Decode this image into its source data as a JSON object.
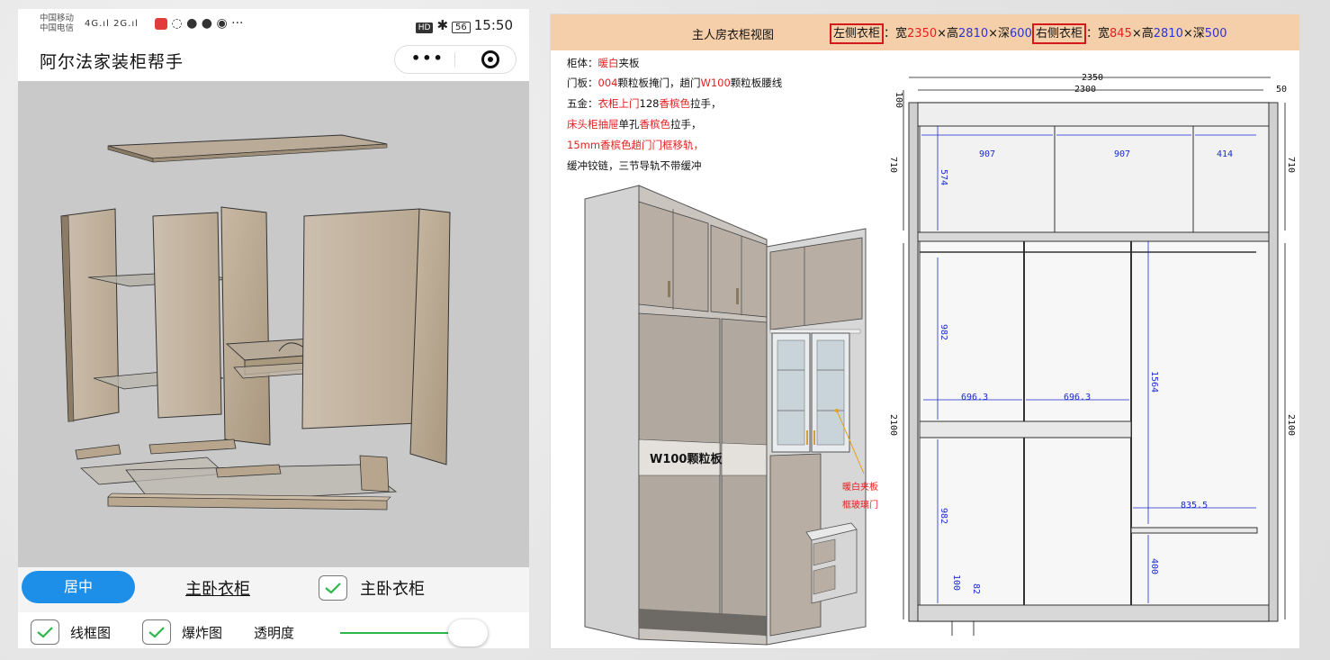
{
  "status": {
    "carrier1": "中国移动",
    "carrier2": "中国电信",
    "net1": "4G",
    "net2": "2G",
    "battery": "56",
    "time": "15:50",
    "hd": "HD"
  },
  "app": {
    "title": "阿尔法家装柜帮手",
    "more_label": "•••"
  },
  "controls": {
    "center_label": "居中",
    "model_link": "主卧衣柜",
    "model_check_label": "主卧衣柜",
    "wireframe_label": "线框图",
    "explode_label": "爆炸图",
    "opacity_label": "透明度",
    "opacity_value": 1.0,
    "accent": "#1e8fe8",
    "check_color": "#2db84c"
  },
  "sheet": {
    "title": "主人房衣柜视图",
    "left_label": "左侧衣柜",
    "left_w": "2350",
    "left_h": "2810",
    "left_d": "600",
    "right_label": "右侧衣柜",
    "right_w": "845",
    "right_h": "2810",
    "right_d": "500",
    "w_prefix": "：宽",
    "h_prefix": "×高",
    "d_prefix": "×深",
    "spec1_a": "柜体：",
    "spec1_b": "暖白",
    "spec1_c": "夹板",
    "spec2_a": "门板：",
    "spec2_b": "004",
    "spec2_c": "颗粒板掩门，趟门",
    "spec2_d": "W100",
    "spec2_e": "颗粒板腰线",
    "spec3_a": "五金：",
    "spec3_b": "衣柜上门",
    "spec3_c": "128",
    "spec3_d": "香槟色",
    "spec3_e": "拉手，",
    "spec4_a": "床头柜抽屉",
    "spec4_b": "单孔",
    "spec4_c": "香槟色",
    "spec4_d": "拉手，",
    "spec5_a": "15mm",
    "spec5_b": "香槟色",
    "spec5_c": "趟门门框移轨，",
    "spec6": "缓冲铰链，三节导轨不带缓冲",
    "panel_label": "W100颗粒板",
    "callout1": "暖白夹板",
    "callout2": "框玻璃门",
    "accent_bg": "#f5cfa9"
  },
  "dims": {
    "overall": "2350",
    "inner": "2300",
    "right_gap": "50",
    "top_gap": "100",
    "top_h_left": "710",
    "top_h_right": "710",
    "top_inner": "574",
    "col1": "907",
    "col2": "907",
    "col3": "414",
    "lower_left": "2100",
    "lower_right": "2100",
    "sec1": "982",
    "sec2": "982",
    "w1": "696.3",
    "w2": "696.3",
    "tall": "1564",
    "w3": "835.5",
    "bottom_h": "400",
    "base": "100",
    "base2": "82"
  }
}
